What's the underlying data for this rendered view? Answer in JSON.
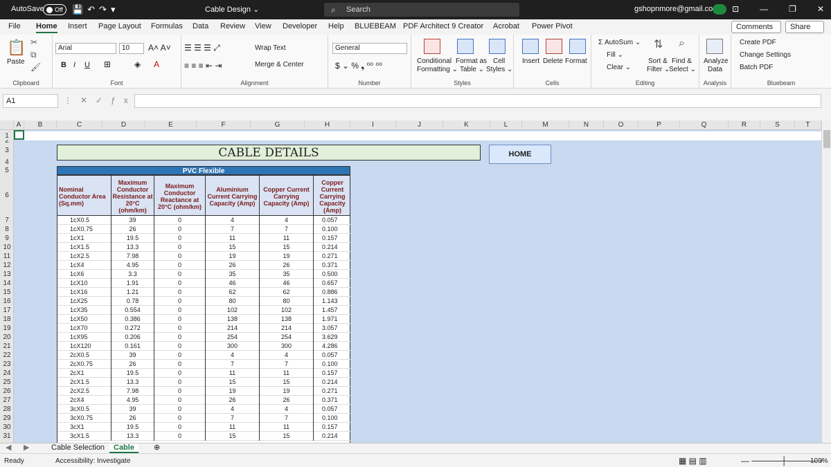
{
  "titlebar": {
    "autosave": "AutoSave",
    "autosave_state": "Off",
    "doc_title": "Cable Design ⌄",
    "search_placeholder": "Search",
    "email": "gshopnmore@gmail.com"
  },
  "menu": [
    "File",
    "Home",
    "Insert",
    "Page Layout",
    "Formulas",
    "Data",
    "Review",
    "View",
    "Developer",
    "Help",
    "BLUEBEAM",
    "PDF Architect 9 Creator",
    "Acrobat",
    "Power Pivot"
  ],
  "menu_active": "Home",
  "comments_label": "Comments",
  "share_label": "Share",
  "ribbon": {
    "clipboard": {
      "paste": "Paste",
      "label": "Clipboard"
    },
    "font": {
      "name": "Arial",
      "size": "10",
      "label": "Font",
      "b": "B",
      "i": "I",
      "u": "U"
    },
    "alignment": {
      "wrap": "Wrap Text",
      "merge": "Merge & Center",
      "label": "Alignment"
    },
    "number": {
      "format": "General",
      "label": "Number"
    },
    "styles": {
      "cond": "Conditional",
      "cond2": "Formatting ⌄",
      "fmt": "Format as",
      "fmt2": "Table ⌄",
      "cell": "Cell",
      "cell2": "Styles ⌄",
      "label": "Styles"
    },
    "cells": {
      "insert": "Insert",
      "delete": "Delete",
      "format": "Format",
      "label": "Cells"
    },
    "editing": {
      "autosum": "Σ AutoSum ⌄",
      "fill": "Fill ⌄",
      "clear": "Clear ⌄",
      "sort": "Sort &",
      "sort2": "Filter ⌄",
      "find": "Find &",
      "find2": "Select ⌄",
      "label": "Editing"
    },
    "analysis": {
      "analyze": "Analyze",
      "analyze2": "Data",
      "label": "Analysis"
    },
    "bluebeam": {
      "create": "Create PDF",
      "change": "Change Settings",
      "batch": "Batch PDF",
      "label": "Bluebeam"
    }
  },
  "namebox": "A1",
  "columns": [
    "A",
    "B",
    "C",
    "D",
    "E",
    "F",
    "G",
    "H",
    "I",
    "J",
    "K",
    "L",
    "M",
    "N",
    "O",
    "P",
    "Q",
    "R",
    "S",
    "T"
  ],
  "rows": [
    "1",
    "2",
    "3",
    "4",
    "5",
    "6",
    "7",
    "8",
    "9",
    "10",
    "11",
    "12",
    "13",
    "14",
    "15",
    "16",
    "17",
    "18",
    "19",
    "20",
    "21",
    "22",
    "23",
    "24",
    "25",
    "26",
    "27",
    "28",
    "29",
    "30",
    "31"
  ],
  "sheet": {
    "title": "CABLE DETAILS",
    "home_button": "HOME",
    "group_header": "PVC Flexible",
    "headers": [
      "Nominal Conductor Area (Sq.mm)",
      "Maximum Conductor Resistance at 20°C (ohm/km)",
      "Maximum Conductor Reactance at 20°C (ohm/km)",
      "Aluminium Current Carrying Capacity (Amp)",
      "Copper Current Carrying Capacity (Amp)",
      "Copper Current Carrying Capacity (Amp)"
    ],
    "table": [
      [
        "1cX0.5",
        "39",
        "0",
        "4",
        "4",
        "0.057"
      ],
      [
        "1cX0.75",
        "26",
        "0",
        "7",
        "7",
        "0.100"
      ],
      [
        "1cX1",
        "19.5",
        "0",
        "11",
        "11",
        "0.157"
      ],
      [
        "1cX1.5",
        "13.3",
        "0",
        "15",
        "15",
        "0.214"
      ],
      [
        "1cX2.5",
        "7.98",
        "0",
        "19",
        "19",
        "0.271"
      ],
      [
        "1cX4",
        "4.95",
        "0",
        "26",
        "26",
        "0.371"
      ],
      [
        "1cX6",
        "3.3",
        "0",
        "35",
        "35",
        "0.500"
      ],
      [
        "1cX10",
        "1.91",
        "0",
        "46",
        "46",
        "0.657"
      ],
      [
        "1cX16",
        "1.21",
        "0",
        "62",
        "62",
        "0.886"
      ],
      [
        "1cX25",
        "0.78",
        "0",
        "80",
        "80",
        "1.143"
      ],
      [
        "1cX35",
        "0.554",
        "0",
        "102",
        "102",
        "1.457"
      ],
      [
        "1cX50",
        "0.386",
        "0",
        "138",
        "138",
        "1.971"
      ],
      [
        "1cX70",
        "0.272",
        "0",
        "214",
        "214",
        "3.057"
      ],
      [
        "1cX95",
        "0.206",
        "0",
        "254",
        "254",
        "3.629"
      ],
      [
        "1cX120",
        "0.161",
        "0",
        "300",
        "300",
        "4.286"
      ],
      [
        "2cX0.5",
        "39",
        "0",
        "4",
        "4",
        "0.057"
      ],
      [
        "2cX0.75",
        "26",
        "0",
        "7",
        "7",
        "0.100"
      ],
      [
        "2cX1",
        "19.5",
        "0",
        "11",
        "11",
        "0.157"
      ],
      [
        "2cX1.5",
        "13.3",
        "0",
        "15",
        "15",
        "0.214"
      ],
      [
        "2cX2.5",
        "7.98",
        "0",
        "19",
        "19",
        "0.271"
      ],
      [
        "2cX4",
        "4.95",
        "0",
        "26",
        "26",
        "0.371"
      ],
      [
        "3cX0.5",
        "39",
        "0",
        "4",
        "4",
        "0.057"
      ],
      [
        "3cX0.75",
        "26",
        "0",
        "7",
        "7",
        "0.100"
      ],
      [
        "3cX1",
        "19.5",
        "0",
        "11",
        "11",
        "0.157"
      ],
      [
        "3cX1.5",
        "13.3",
        "0",
        "15",
        "15",
        "0.214"
      ]
    ]
  },
  "tabs": [
    "Cable Selection",
    "Cable"
  ],
  "active_tab": "Cable",
  "status": {
    "ready": "Ready",
    "accessibility": "Accessibility: Investigate",
    "zoom": "100%"
  }
}
